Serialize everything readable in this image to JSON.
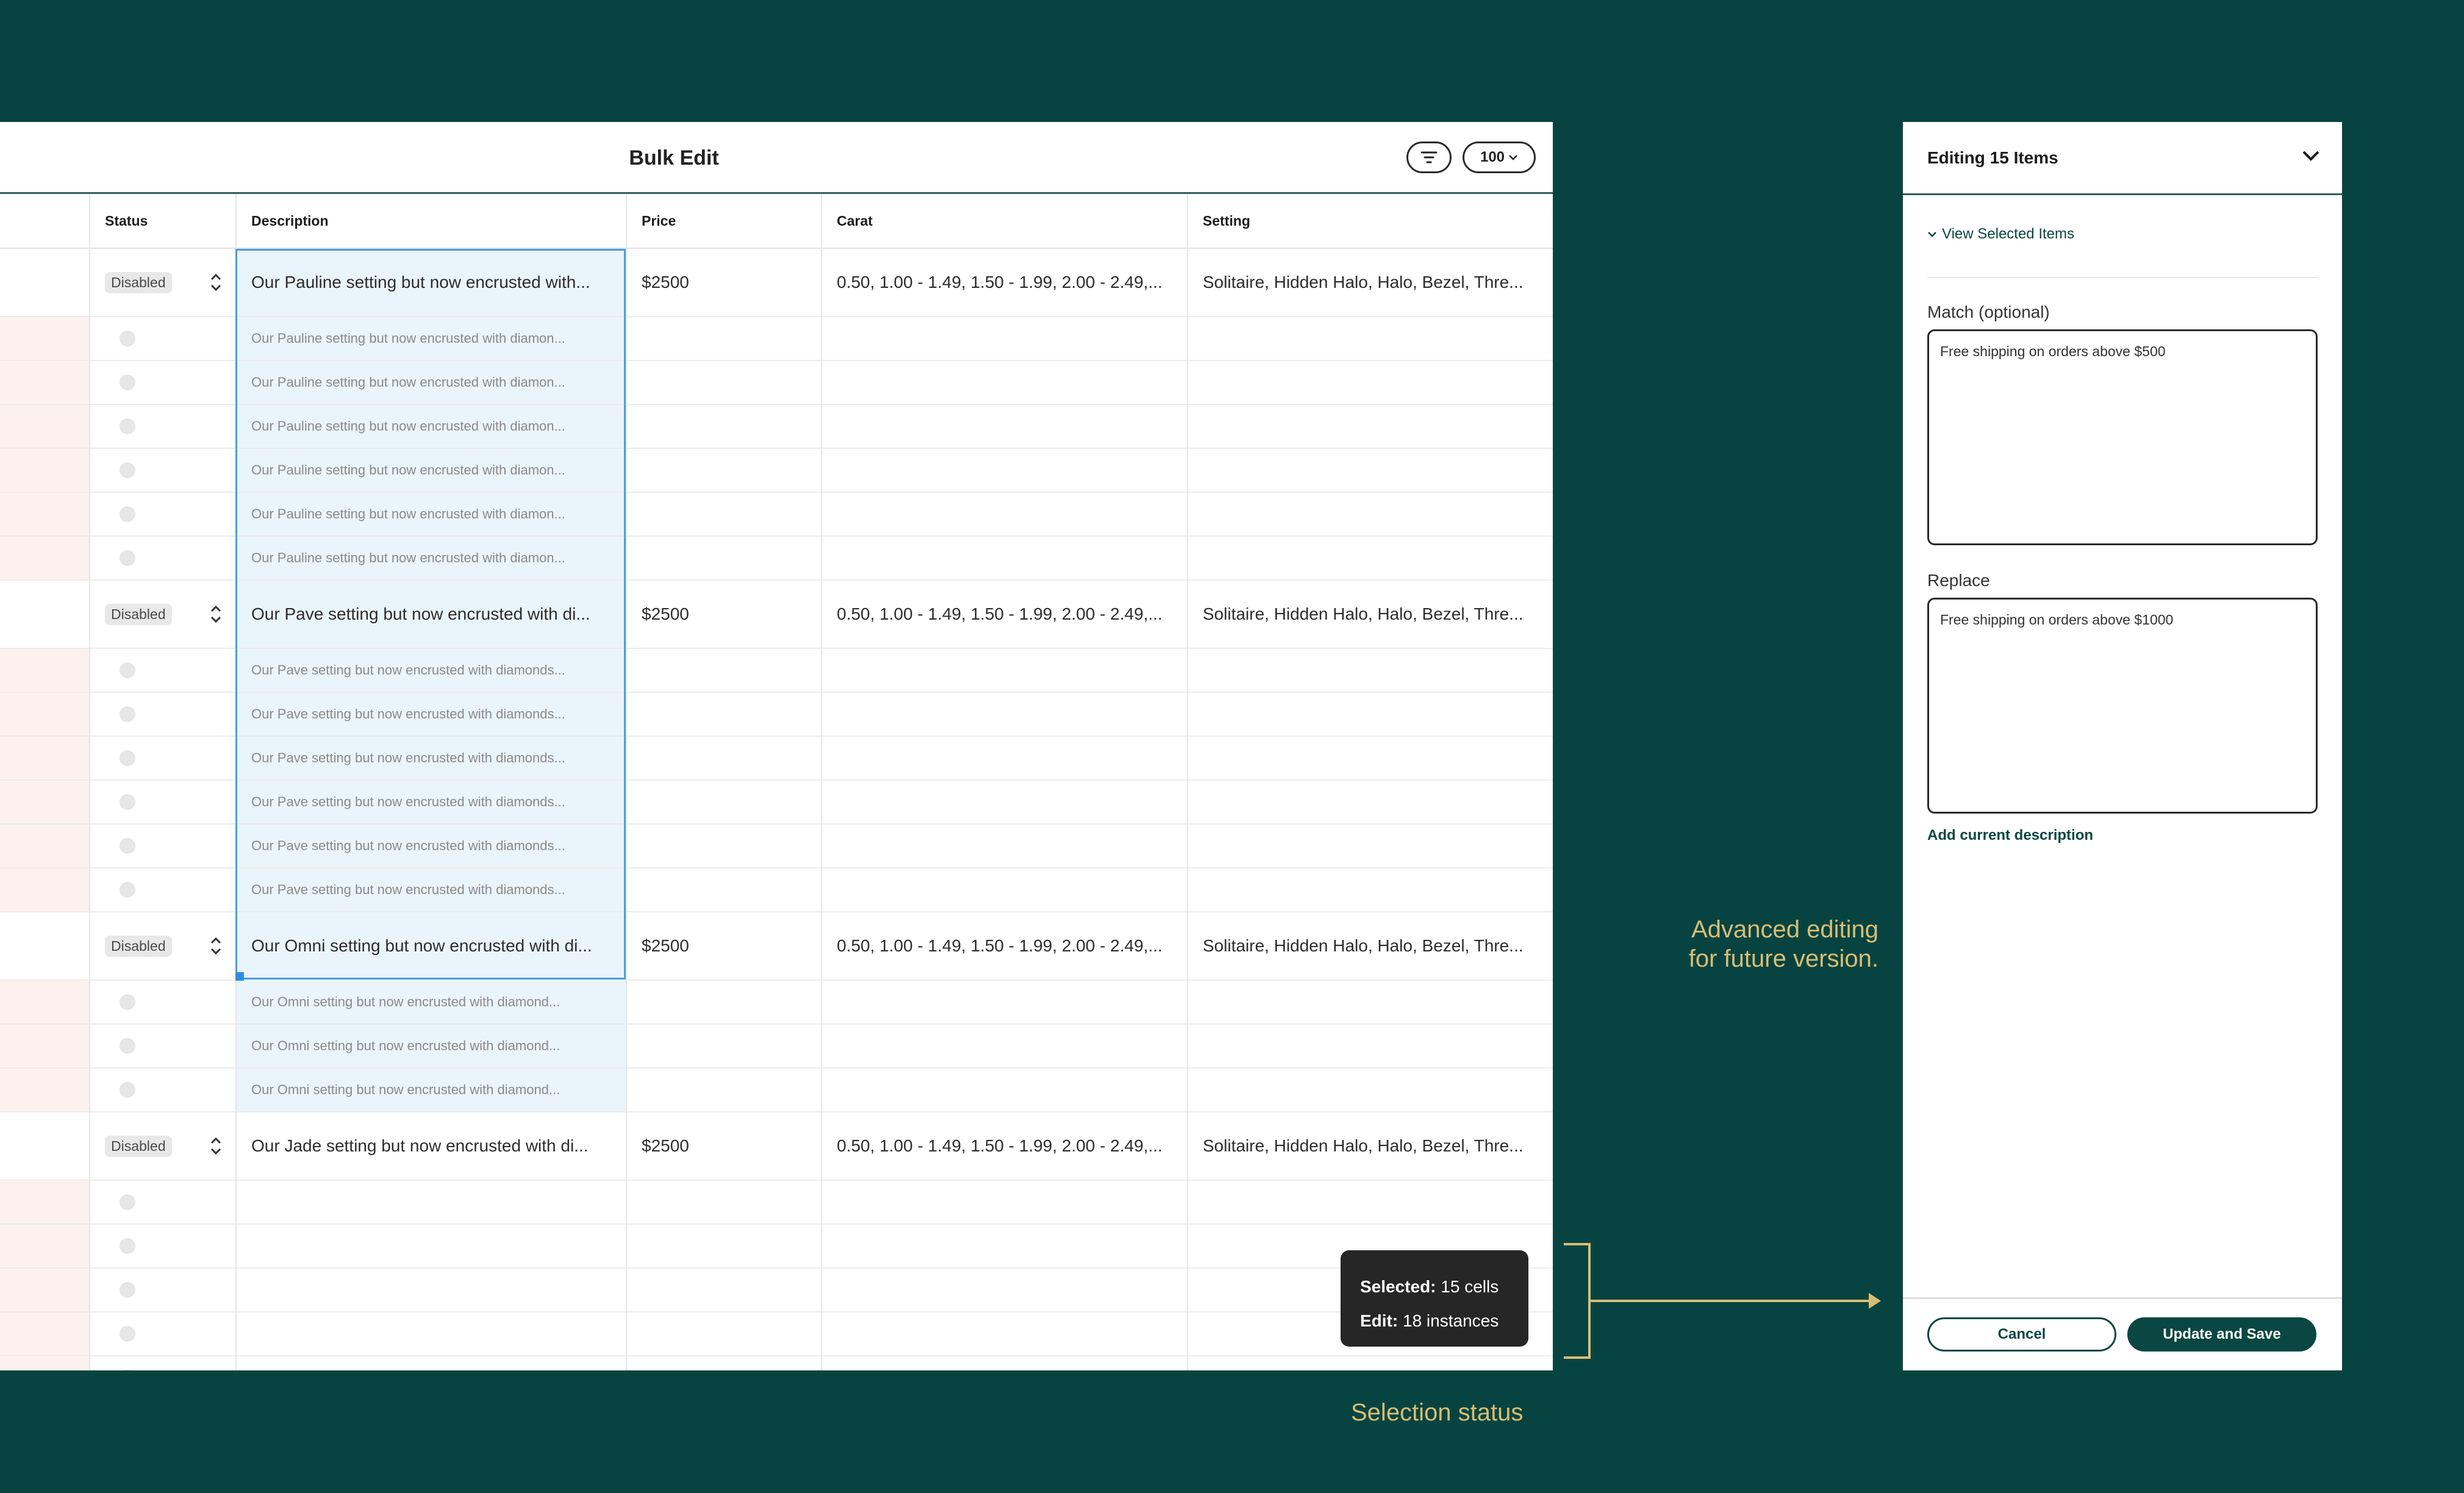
{
  "colors": {
    "background": "#074441",
    "accent": "#0b4742",
    "selection": "#4a9fd9",
    "annotation": "#d9bd74"
  },
  "table": {
    "title": "Bulk Edit",
    "page_size": "100",
    "columns": [
      "Status",
      "Description",
      "Price",
      "Carat",
      "Setting"
    ],
    "groups": [
      {
        "status": "Disabled",
        "description": "Our Pauline setting but now encrusted with...",
        "price": "$2500",
        "carat": "0.50, 1.00 - 1.49, 1.50 - 1.99, 2.00 - 2.49,...",
        "setting": "Solitaire, Hidden Halo, Halo, Bezel, Thre...",
        "sub_rows": [
          "Our Pauline setting but now encrusted with diamon...",
          "Our Pauline setting but now encrusted with diamon...",
          "Our Pauline setting but now encrusted with diamon...",
          "Our Pauline setting but now encrusted with diamon...",
          "Our Pauline setting but now encrusted with diamon...",
          "Our Pauline setting but now encrusted with diamon..."
        ]
      },
      {
        "status": "Disabled",
        "description": "Our Pave setting but now encrusted with di...",
        "price": "$2500",
        "carat": "0.50, 1.00 - 1.49, 1.50 - 1.99, 2.00 - 2.49,...",
        "setting": "Solitaire, Hidden Halo, Halo, Bezel, Thre...",
        "sub_rows": [
          "Our Pave setting but now encrusted with diamonds...",
          "Our Pave setting but now encrusted with diamonds...",
          "Our Pave setting but now encrusted with diamonds...",
          "Our Pave setting but now encrusted with diamonds...",
          "Our Pave setting but now encrusted with diamonds...",
          "Our Pave setting but now encrusted with diamonds..."
        ]
      },
      {
        "status": "Disabled",
        "description": "Our Omni setting but now encrusted with di...",
        "price": "$2500",
        "carat": "0.50, 1.00 - 1.49, 1.50 - 1.99, 2.00 - 2.49,...",
        "setting": "Solitaire, Hidden Halo, Halo, Bezel, Thre...",
        "sub_rows": [
          "Our Omni setting but now encrusted with diamond...",
          "Our Omni setting but now encrusted with diamond...",
          "Our Omni setting but now encrusted with diamond..."
        ]
      },
      {
        "status": "Disabled",
        "description": "Our Jade setting but now encrusted with di...",
        "price": "$2500",
        "carat": "0.50, 1.00 - 1.49, 1.50 - 1.99, 2.00 - 2.49,...",
        "setting": "Solitaire, Hidden Halo, Halo, Bezel, Thre...",
        "sub_rows": [
          "",
          "",
          "",
          "",
          ""
        ]
      }
    ]
  },
  "tooltip": {
    "selected_label": "Selected:",
    "selected_value": "15 cells",
    "edit_label": "Edit:",
    "edit_value": "18 instances"
  },
  "annotations": {
    "advanced_line1": "Advanced editing",
    "advanced_line2": "for future version.",
    "selection_status": "Selection status"
  },
  "side_panel": {
    "title": "Editing 15 Items",
    "view_selected": "View Selected Items",
    "match_label": "Match (optional)",
    "match_value": "Free shipping on orders above $500",
    "replace_label": "Replace",
    "replace_value": "Free shipping on orders above $1000",
    "add_current": "Add current description",
    "cancel": "Cancel",
    "save": "Update and Save"
  }
}
